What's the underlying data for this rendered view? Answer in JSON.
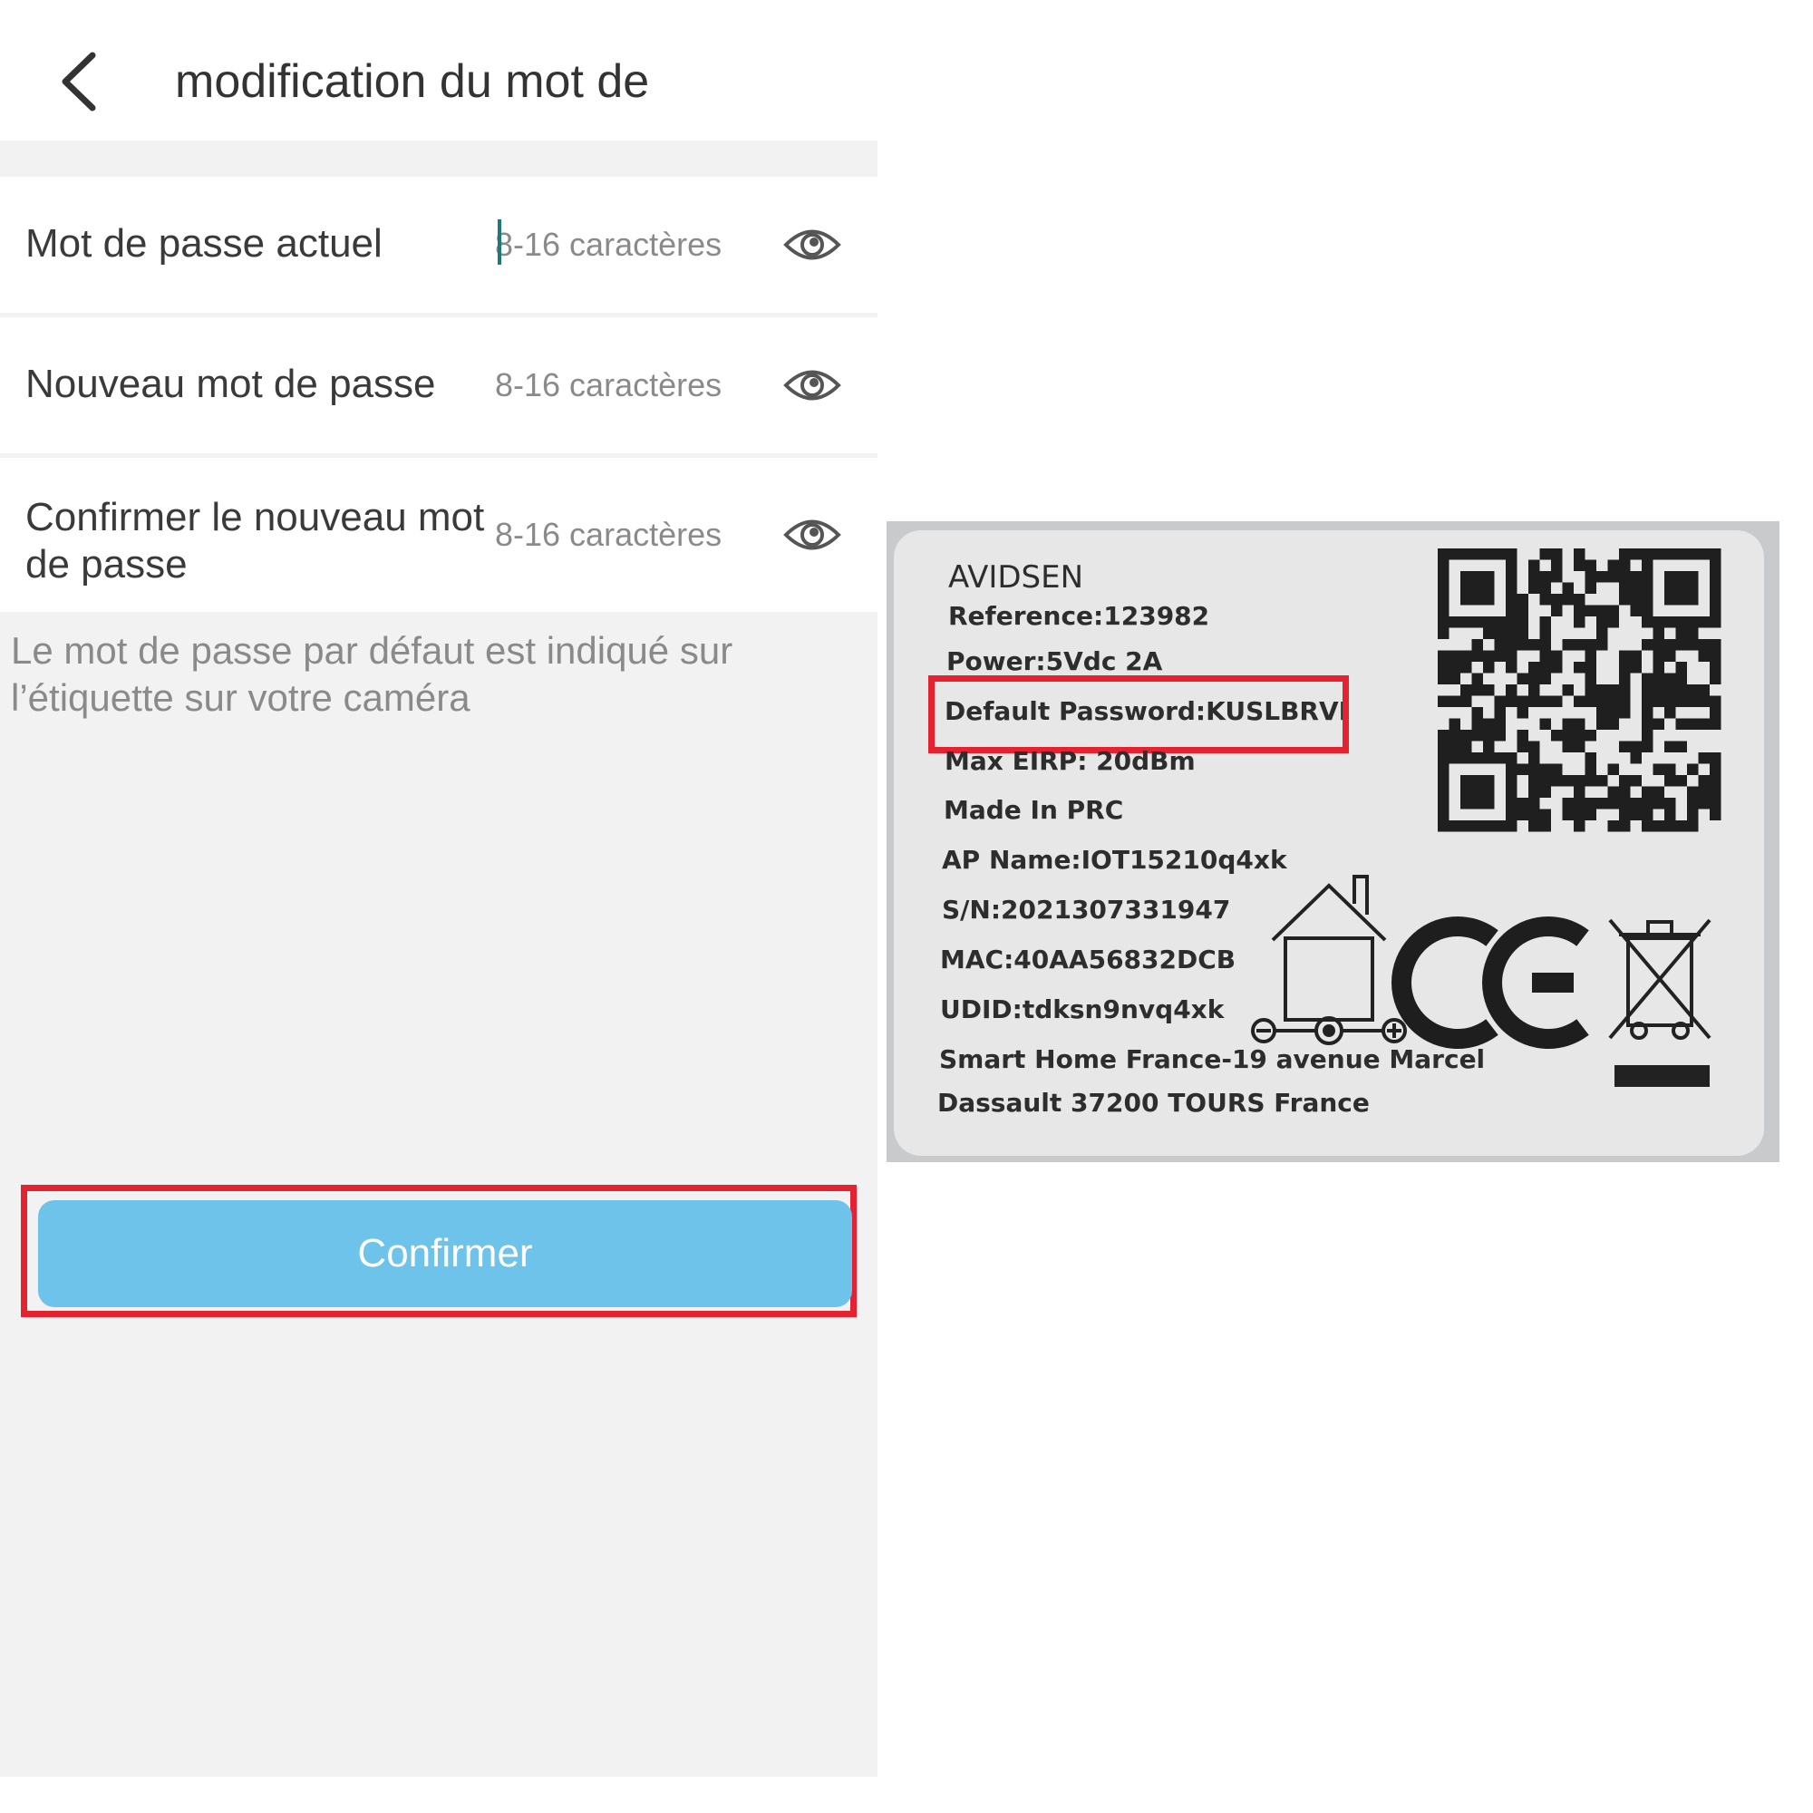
{
  "screen": {
    "title": "modification du mot de",
    "fields": [
      {
        "label": "Mot de passe actuel",
        "placeholder": "8-16 caractères"
      },
      {
        "label": "Nouveau mot de passe",
        "placeholder": "8-16 caractères"
      },
      {
        "label": "Confirmer le nouveau mot de passe",
        "placeholder": "8-16 caractères"
      }
    ],
    "hint": "Le mot de passe par défaut est indiqué sur l’étiquette sur votre caméra",
    "confirm_label": "Confirmer",
    "icons": {
      "back": "chevron-left-icon",
      "visibility": "eye-icon"
    },
    "colors": {
      "button": "#6ec3ea",
      "highlight": "#e52330",
      "caret": "#1e7a78"
    }
  },
  "label_photo": {
    "brand": "AVIDSEN",
    "reference": "Reference:123982",
    "power": "Power:5Vdc 2A",
    "default_password": "Default Password:KUSLBRVI",
    "max_eirp": "Max EIRP: 20dBm",
    "made_in": "Made In PRC",
    "ap_name": "AP Name:IOT15210q4xk",
    "serial": "S/N:2021307331947",
    "mac": "MAC:40AA56832DCB",
    "udid": "UDID:tdksn9nvq4xk",
    "address_line1": "Smart Home France-19 avenue Marcel",
    "address_line2": "Dassault 37200 TOURS  France"
  }
}
